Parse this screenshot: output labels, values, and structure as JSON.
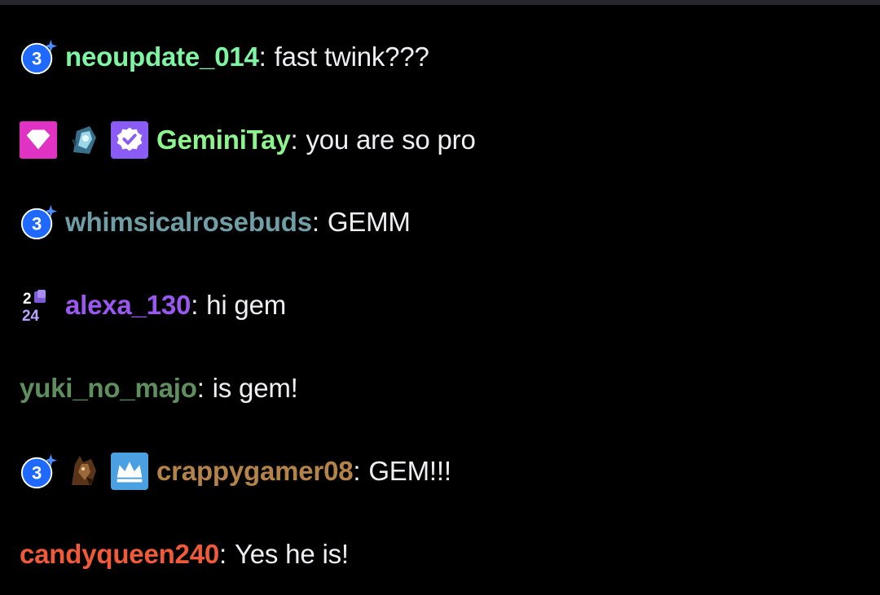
{
  "colors": {
    "background": "#000000",
    "message_text": "#efeff1",
    "sub_badge_blue": "#1f69ff",
    "prime_pink": "#e033c4",
    "verified_purple": "#8a5cf5",
    "crown_blue": "#4aa0e0"
  },
  "messages": [
    {
      "username": "neoupdate_014",
      "color": "#7ef5a3",
      "badges": [
        "sub-3-icon"
      ],
      "colon": ":",
      "text": "fast twink???"
    },
    {
      "username": "GeminiTay",
      "color": "#8df58e",
      "badges": [
        "gem-icon",
        "avatar-emote-icon",
        "verified-check-icon"
      ],
      "colon": ":",
      "text": "you are so pro"
    },
    {
      "username": "whimsicalrosebuds",
      "color": "#6f9ea6",
      "badges": [
        "sub-3-icon"
      ],
      "colon": ":",
      "text": "GEMM"
    },
    {
      "username": "alexa_130",
      "color": "#9a58f0",
      "badges": [
        "year-2024-icon"
      ],
      "colon": ":",
      "text": "hi gem"
    },
    {
      "username": "yuki_no_majo",
      "color": "#5f8f5f",
      "badges": [],
      "colon": ":",
      "text": "is gem!"
    },
    {
      "username": "crappygamer08",
      "color": "#b38348",
      "badges": [
        "sub-3-icon",
        "wolf-emote-icon",
        "crown-icon"
      ],
      "colon": ":",
      "text": "GEM!!!"
    },
    {
      "username": "candyqueen240",
      "color": "#f05a38",
      "badges": [],
      "colon": ":",
      "text": "Yes he is!"
    }
  ]
}
